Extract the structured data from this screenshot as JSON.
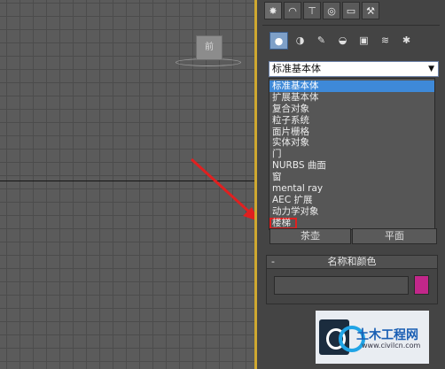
{
  "viewport": {
    "viewcube_label": "前"
  },
  "panel": {
    "tabs": [
      "✸",
      "◠",
      "⊤",
      "◎",
      "▭",
      "⚒"
    ],
    "type_icons": [
      "●",
      "◑",
      "✎",
      "◒",
      "▣",
      "≋",
      "✱"
    ],
    "dropdown": {
      "selected": "标准基本体",
      "options": [
        "标准基本体",
        "扩展基本体",
        "复合对象",
        "粒子系统",
        "面片栅格",
        "实体对象",
        "门",
        "NURBS 曲面",
        "窗",
        "mental ray",
        "AEC 扩展",
        "动力学对象",
        "楼梯"
      ],
      "highlighted_index": 0,
      "boxed_index": 12
    },
    "buttons": {
      "left_label": "茶壶",
      "right_label": "平面"
    },
    "rollout": {
      "title": "名称和颜色",
      "collapse_symbol": "-",
      "name_value": "",
      "color": "#c2278a"
    },
    "annotation_color": "#e02020",
    "accent_color": "#3e89d8"
  },
  "watermark": {
    "title": "土木工程网",
    "url": "www.civilcn.com"
  }
}
